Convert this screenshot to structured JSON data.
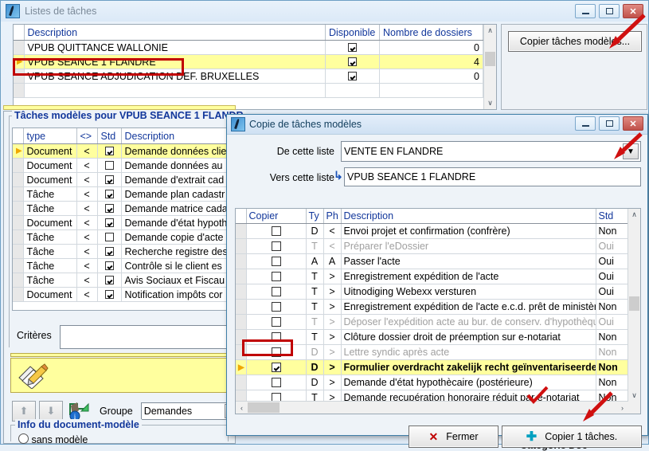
{
  "window": {
    "title": "Listes de tâches",
    "icon": "app-icon",
    "buttons": {
      "minimize": "–",
      "maximize": "□",
      "close": "✕"
    }
  },
  "lists_grid": {
    "columns": [
      "Description",
      "Disponible",
      "Nombre de dossiers"
    ],
    "rows": [
      {
        "description": "VPUB QUITTANCE WALLONIE",
        "disponible": true,
        "dossiers": "0",
        "selected": false
      },
      {
        "description": "VPUB SEANCE 1 FLANDRE",
        "disponible": true,
        "dossiers": "4",
        "selected": true
      },
      {
        "description": "VPUB SEANCE ADJUDICATION DEF. BRUXELLES",
        "disponible": true,
        "dossiers": "0",
        "selected": false
      }
    ]
  },
  "right_pane": {
    "copy_models_button": "Copier tâches modèles..."
  },
  "models_panel": {
    "legend": "Tâches modèles pour VPUB SEANCE 1 FLANDR",
    "columns": [
      "type",
      "<>",
      "Std",
      "Description"
    ],
    "rows": [
      {
        "type": "Document",
        "dir": "<",
        "std": true,
        "description": "Demande données clie",
        "selected": true
      },
      {
        "type": "Document",
        "dir": "<",
        "std": false,
        "description": "Demande données au",
        "selected": false
      },
      {
        "type": "Document",
        "dir": "<",
        "std": true,
        "description": "Demande d'extrait cad",
        "selected": false
      },
      {
        "type": "Tâche",
        "dir": "<",
        "std": true,
        "description": "Demande plan cadastr",
        "selected": false
      },
      {
        "type": "Tâche",
        "dir": "<",
        "std": true,
        "description": "Demande matrice cada",
        "selected": false
      },
      {
        "type": "Document",
        "dir": "<",
        "std": true,
        "description": "Demande d'état hypoth",
        "selected": false
      },
      {
        "type": "Tâche",
        "dir": "<",
        "std": false,
        "description": "Demande copie d'acte",
        "selected": false
      },
      {
        "type": "Tâche",
        "dir": "<",
        "std": true,
        "description": "Recherche registre des",
        "selected": false
      },
      {
        "type": "Tâche",
        "dir": "<",
        "std": true,
        "description": "Contrôle si le client es",
        "selected": false
      },
      {
        "type": "Tâche",
        "dir": "<",
        "std": true,
        "description": "Avis Sociaux et Fiscau",
        "selected": false
      },
      {
        "type": "Document",
        "dir": "<",
        "std": true,
        "description": "Notification impôts cor",
        "selected": false
      }
    ],
    "criteria_label": "Critères",
    "criteria_value": "",
    "group_label": "Groupe",
    "group_value": "Demandes",
    "up_arrow": "⬆",
    "down_arrow": "⬇",
    "info_icon": "info-arrow-icon",
    "doc_info_legend": "Info du document-modèle",
    "doc_info_option": "sans modèle"
  },
  "dialog": {
    "title": "Copie de tâches modèles",
    "buttons": {
      "minimize": "–",
      "maximize": "□",
      "close": "✕"
    },
    "from_label": "De cette liste",
    "from_value": "VENTE EN FLANDRE",
    "to_label": "Vers cette liste",
    "to_value": "VPUB SEANCE 1 FLANDRE",
    "columns": [
      "Copier",
      "Ty",
      "Ph",
      "Description",
      "Std"
    ],
    "rows": [
      {
        "copier": false,
        "ty": "D",
        "ph": "<",
        "description": "Envoi projet et confirmation (confrère)",
        "std": "Non",
        "dim": false,
        "highlight": false
      },
      {
        "copier": false,
        "ty": "T",
        "ph": "<",
        "description": "Préparer l'eDossier",
        "std": "Oui",
        "dim": true,
        "highlight": false
      },
      {
        "copier": false,
        "ty": "A",
        "ph": "A",
        "description": "Passer l'acte",
        "std": "Oui",
        "dim": false,
        "highlight": false
      },
      {
        "copier": false,
        "ty": "T",
        "ph": ">",
        "description": "Enregistrement expédition de l'acte",
        "std": "Oui",
        "dim": false,
        "highlight": false
      },
      {
        "copier": false,
        "ty": "T",
        "ph": ">",
        "description": "Uitnodiging Webexx versturen",
        "std": "Oui",
        "dim": false,
        "highlight": false
      },
      {
        "copier": false,
        "ty": "T",
        "ph": ">",
        "description": "Enregistrement expédition de l'acte e.c.d. prêt de ministère",
        "std": "Non",
        "dim": false,
        "highlight": false
      },
      {
        "copier": false,
        "ty": "T",
        "ph": ">",
        "description": "Déposer l'expédition acte au bur. de conserv. d'hypothèques",
        "std": "Oui",
        "dim": true,
        "highlight": false
      },
      {
        "copier": false,
        "ty": "T",
        "ph": ">",
        "description": "Clôture dossier droit de préemption sur e-notariat",
        "std": "Non",
        "dim": false,
        "highlight": false
      },
      {
        "copier": false,
        "ty": "D",
        "ph": ">",
        "description": "Lettre syndic après acte",
        "std": "Non",
        "dim": true,
        "highlight": false
      },
      {
        "copier": true,
        "ty": "D",
        "ph": ">",
        "description": "Formulier overdracht zakelijk recht geïnventariseerde",
        "std": "Non",
        "dim": false,
        "highlight": true
      },
      {
        "copier": false,
        "ty": "D",
        "ph": ">",
        "description": "Demande d'état hypothècaire (postérieure)",
        "std": "Non",
        "dim": false,
        "highlight": false
      },
      {
        "copier": false,
        "ty": "T",
        "ph": ">",
        "description": "Demande recupération honoraire réduit par e-notariat",
        "std": "Non",
        "dim": false,
        "highlight": false
      }
    ],
    "close_button": "Fermer",
    "copy_button": "Copier 1 tâches.",
    "close_icon": "x-mark-icon",
    "copy_icon": "plus-icon"
  },
  "background": {
    "cut_label": "Catégorie Doc"
  },
  "colors": {
    "highlight": "#ffff9e",
    "header_text": "#12379b",
    "annotation_red": "#c00000",
    "dialog_border": "#3f7fa8"
  }
}
